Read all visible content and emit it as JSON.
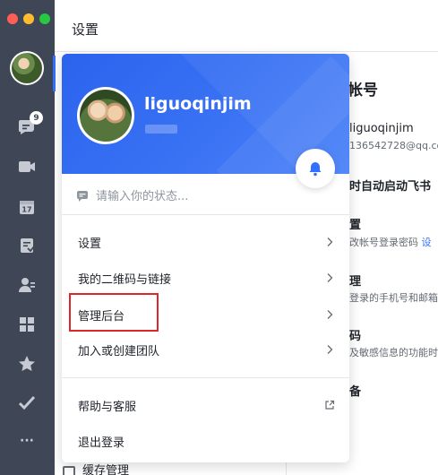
{
  "header": {
    "title": "设置"
  },
  "sidebar": {
    "unread_count": "9",
    "icons": [
      "chat-icon",
      "video-icon",
      "calendar-icon",
      "docs-icon",
      "contacts-icon",
      "apps-icon",
      "favorites-icon",
      "tasks-icon",
      "more-icon"
    ],
    "calendar_day": "17",
    "more_glyph": "···"
  },
  "background": {
    "account_heading": "帐号",
    "account_name": "liguoqinjim",
    "account_email": "136542728@qq.com",
    "autostart": "时自动启动飞书",
    "row1_title": "置",
    "row1_desc": "改帐号登录密码",
    "row1_link": "设",
    "row2_title": "理",
    "row2_desc": "登录的手机号和邮箱",
    "row3_title": "码",
    "row3_desc": "及敏感信息的功能时",
    "row4_title": "备",
    "bottom_item": "缓存管理"
  },
  "profile_card": {
    "username": "liguoqinjim",
    "status_placeholder": "请输入你的状态...",
    "menu": [
      {
        "label": "设置",
        "trailing": "chevron-right-icon"
      },
      {
        "label": "我的二维码与链接",
        "trailing": "chevron-right-icon"
      },
      {
        "label": "管理后台",
        "trailing": "chevron-right-icon"
      },
      {
        "label": "加入或创建团队",
        "trailing": "chevron-right-icon"
      },
      {
        "label": "帮助与客服",
        "trailing": "external-link-icon"
      },
      {
        "label": "退出登录"
      }
    ]
  },
  "colors": {
    "sidebar_bg": "#3f4656",
    "accent": "#3370ff",
    "card_header": "#2b63ee",
    "highlight_border": "#e0262d"
  }
}
